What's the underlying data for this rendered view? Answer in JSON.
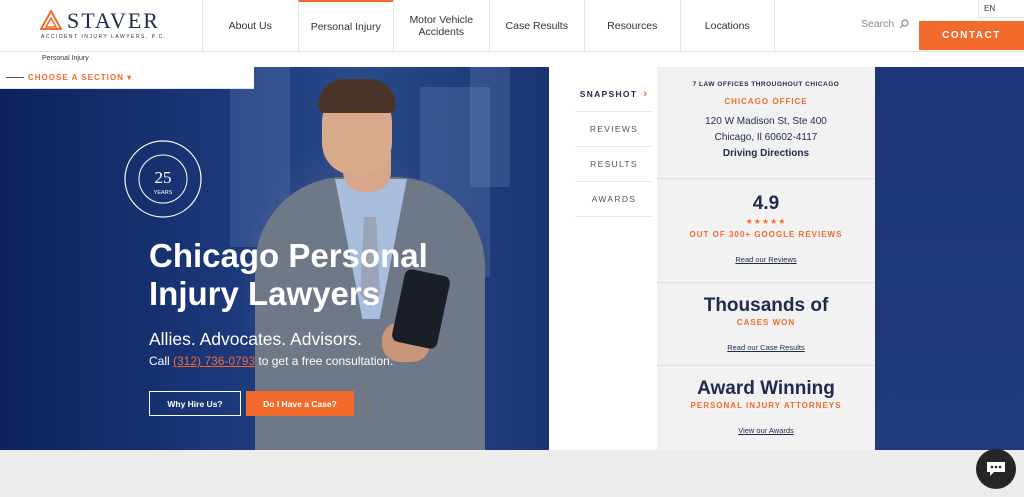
{
  "logo": {
    "word": "STAVER",
    "sub": "ACCIDENT INJURY LAWYERS, P.C."
  },
  "nav": [
    {
      "label": "About Us"
    },
    {
      "label": "Personal Injury"
    },
    {
      "label": "Motor Vehicle Accidents"
    },
    {
      "label": "Case Results"
    },
    {
      "label": "Resources"
    },
    {
      "label": "Locations"
    }
  ],
  "nav_active_index": 1,
  "search": {
    "placeholder": "Search"
  },
  "language": "EN",
  "contact_label": "CONTACT",
  "breadcrumb": "Personal Injury",
  "section_picker": "CHOOSE A SECTION ▾",
  "badge": {
    "number": "25",
    "word": "YEARS"
  },
  "hero": {
    "title": "Chicago Personal Injury Lawyers",
    "tagline": "Allies. Advocates. Advisors.",
    "call_prefix": "Call ",
    "phone": "(312) 736-0793",
    "call_suffix": " to get a free consultation.",
    "btn_why": "Why Hire Us?",
    "btn_case": "Do I Have a Case?"
  },
  "tabs": [
    {
      "label": "SNAPSHOT"
    },
    {
      "label": "REVIEWS"
    },
    {
      "label": "RESULTS"
    },
    {
      "label": "AWARDS"
    }
  ],
  "office": {
    "heading": "7 LAW OFFICES THROUGHOUT CHICAGO",
    "name": "CHICAGO OFFICE",
    "address1": "120 W Madison St, Ste 400",
    "address2": "Chicago, Il 60602-4117",
    "directions": "Driving Directions"
  },
  "rating": {
    "score": "4.9",
    "stars": "★★★★★",
    "label": "OUT OF 300+ GOOGLE REVIEWS",
    "link": "Read our Reviews"
  },
  "cases": {
    "headline": "Thousands of",
    "label": "CASES WON",
    "link": "Read our Case Results"
  },
  "awards": {
    "headline": "Award Winning",
    "label": "PERSONAL INJURY ATTORNEYS",
    "link": "View our Awards"
  },
  "colors": {
    "accent": "#f26b2c",
    "navy": "#1f2a4d",
    "hero_blue": "#1d3a7d"
  }
}
